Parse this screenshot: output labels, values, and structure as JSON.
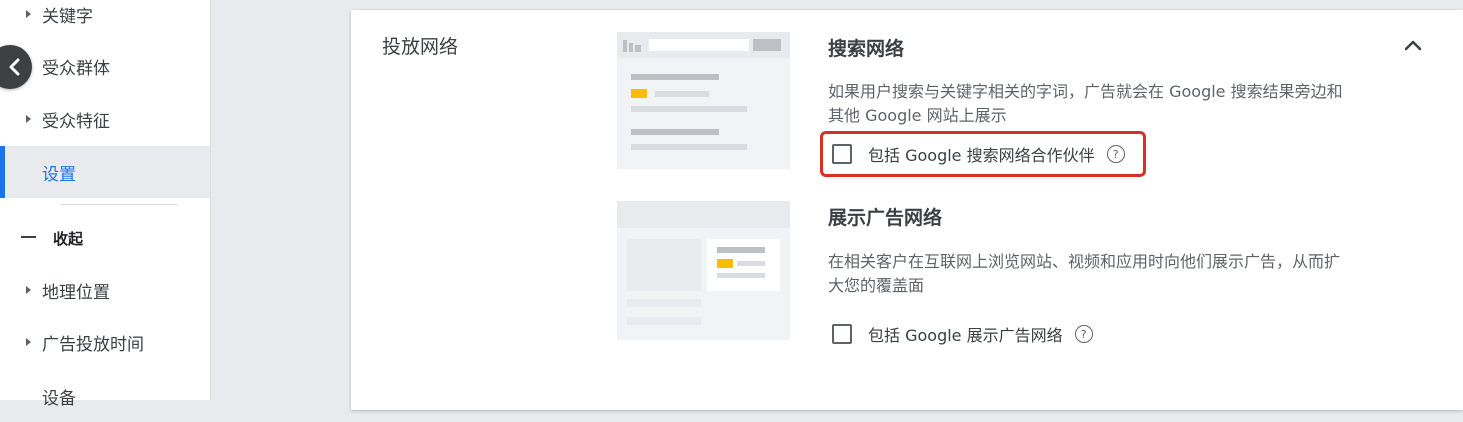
{
  "sidebar": {
    "items": [
      {
        "label": "关键字"
      },
      {
        "label": "受众群体"
      },
      {
        "label": "受众特征"
      },
      {
        "label": "设置"
      },
      {
        "label": "地理位置"
      },
      {
        "label": "广告投放时间"
      },
      {
        "label": "设备"
      }
    ],
    "collapse_label": "收起",
    "back_icon": "chevron-left-icon"
  },
  "card": {
    "section_title": "投放网络",
    "search_network": {
      "title": "搜索网络",
      "description": "如果用户搜索与关键字相关的字词，广告就会在 Google 搜索结果旁边和其他 Google 网站上展示",
      "checkbox_label": "包括 Google 搜索网络合作伙伴",
      "checked": false
    },
    "display_network": {
      "title": "展示广告网络",
      "description": "在相关客户在互联网上浏览网站、视频和应用时向他们展示广告，从而扩大您的覆盖面",
      "checkbox_label": "包括 Google 展示广告网络",
      "checked": false
    },
    "collapse_icon": "chevron-up-icon"
  },
  "colors": {
    "accent": "#1a73e8",
    "highlight": "#d93025",
    "illustration_yellow": "#fbbc04"
  }
}
